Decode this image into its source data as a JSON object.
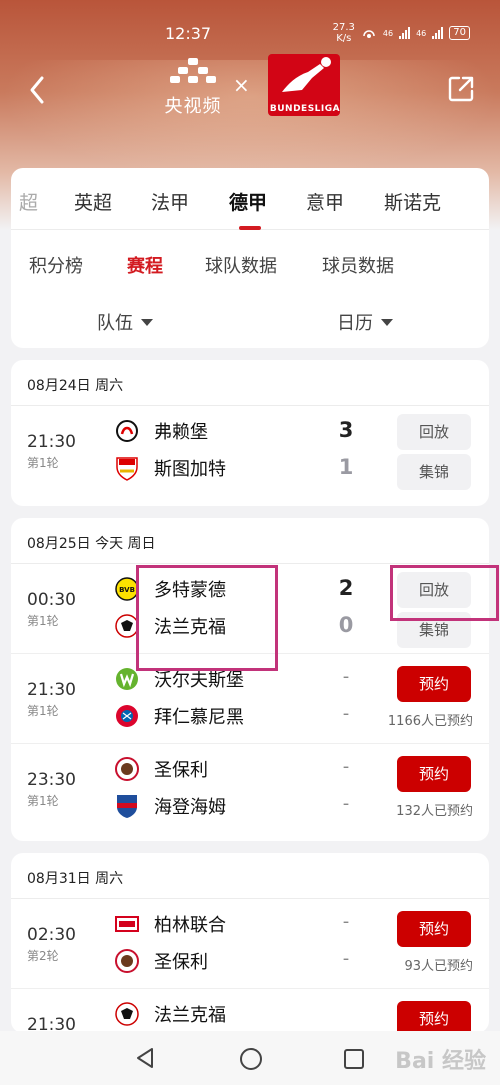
{
  "status_bar": {
    "time": "12:37",
    "net_speed_value": "27.3",
    "net_speed_unit": "K/s",
    "network_1": "46",
    "network_2": "46",
    "battery": "70"
  },
  "header": {
    "cctv_name": "央视频",
    "times_symbol": "×",
    "partner_logo_text": "BUNDESLIGA",
    "icons": [
      "back-arrow-icon",
      "share-icon"
    ]
  },
  "league_tabs": [
    {
      "label": "超",
      "state": "faded"
    },
    {
      "label": "英超",
      "state": "normal"
    },
    {
      "label": "法甲",
      "state": "normal"
    },
    {
      "label": "德甲",
      "state": "active"
    },
    {
      "label": "意甲",
      "state": "normal"
    },
    {
      "label": "斯诺克",
      "state": "normal"
    }
  ],
  "sub_tabs": [
    {
      "label": "积分榜",
      "active": false
    },
    {
      "label": "赛程",
      "active": true
    },
    {
      "label": "球队数据",
      "active": false
    },
    {
      "label": "球员数据",
      "active": false
    }
  ],
  "filters": {
    "team": "队伍",
    "calendar": "日历"
  },
  "days": [
    {
      "date": "08月24日 周六",
      "matches": [
        {
          "time": "21:30",
          "round": "第1轮",
          "home": "弗赖堡",
          "away": "斯图加特",
          "home_score": "3",
          "away_score": "1",
          "buttons": [
            "回放",
            "集锦"
          ]
        }
      ]
    },
    {
      "date": "08月25日 今天 周日",
      "matches": [
        {
          "time": "00:30",
          "round": "第1轮",
          "home": "多特蒙德",
          "away": "法兰克福",
          "home_score": "2",
          "away_score": "0",
          "buttons": [
            "回放",
            "集锦"
          ]
        },
        {
          "time": "21:30",
          "round": "第1轮",
          "home": "沃尔夫斯堡",
          "away": "拜仁慕尼黑",
          "home_score": "-",
          "away_score": "-",
          "reserve": "预约",
          "reserve_count": "1166人已预约"
        },
        {
          "time": "23:30",
          "round": "第1轮",
          "home": "圣保利",
          "away": "海登海姆",
          "home_score": "-",
          "away_score": "-",
          "reserve": "预约",
          "reserve_count": "132人已预约"
        }
      ]
    },
    {
      "date": "08月31日 周六",
      "matches": [
        {
          "time": "02:30",
          "round": "第2轮",
          "home": "柏林联合",
          "away": "圣保利",
          "home_score": "-",
          "away_score": "-",
          "reserve": "预约",
          "reserve_count": "93人已预约"
        },
        {
          "time": "21:30",
          "round": "",
          "home": "法兰克福",
          "away": "",
          "home_score": "",
          "away_score": "",
          "reserve": "预约",
          "reserve_count": ""
        }
      ]
    }
  ],
  "watermark": "Bai 经验",
  "colors": {
    "accent_red": "#d31b21",
    "reserve_red": "#cc0000",
    "highlight": "#c2337a"
  }
}
